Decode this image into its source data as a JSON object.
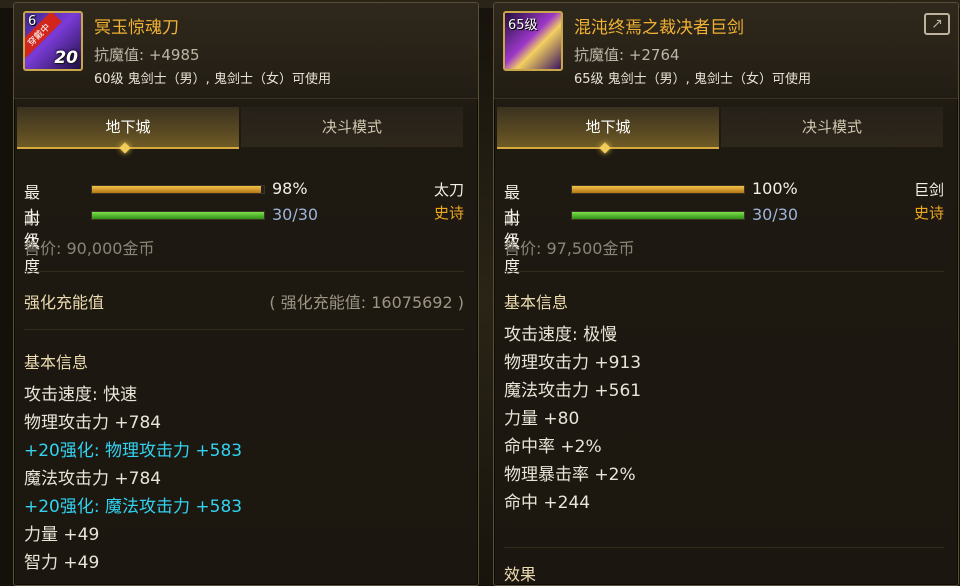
{
  "left": {
    "item": {
      "icon_level": "6",
      "icon_stamp": "穿戴中",
      "icon_plus": "20",
      "name": "冥玉惊魂刀",
      "resist": "抗魔值: +4985",
      "requirement": "60级 鬼剑士（男）, 鬼剑士（女）可使用"
    },
    "tabs": [
      {
        "label": "地下城",
        "active": true
      },
      {
        "label": "决斗模式",
        "active": false
      }
    ],
    "stats": {
      "grade_label": "最上级",
      "grade_value": "98%",
      "grade_fraction": 0.98,
      "durability_label": "耐久度",
      "durability_value": "30/30",
      "durability_fraction": 1.0
    },
    "type": "太刀",
    "rarity": "史诗",
    "price": "售价: 90,000金币",
    "charge": {
      "label": "强化充能值",
      "value": "( 强化充能值: 16075692 )"
    },
    "basic_title": "基本信息",
    "attributes": [
      {
        "text": "攻击速度: 快速",
        "color": "white"
      },
      {
        "text": "物理攻击力 +784",
        "color": "white"
      },
      {
        "text": "+20强化: 物理攻击力 +583",
        "color": "cyan"
      },
      {
        "text": "魔法攻击力 +784",
        "color": "white"
      },
      {
        "text": "+20强化: 魔法攻击力 +583",
        "color": "cyan"
      },
      {
        "text": "力量 +49",
        "color": "white"
      },
      {
        "text": "智力 +49",
        "color": "white"
      }
    ]
  },
  "right": {
    "item": {
      "icon_level": "65级",
      "name": "混沌终焉之裁决者巨剑",
      "resist": "抗魔值: +2764",
      "requirement": "65级 鬼剑士（男）, 鬼剑士（女）可使用"
    },
    "share_icon": "share-icon",
    "tabs": [
      {
        "label": "地下城",
        "active": true
      },
      {
        "label": "决斗模式",
        "active": false
      }
    ],
    "stats": {
      "grade_label": "最上级",
      "grade_value": "100%",
      "grade_fraction": 1.0,
      "durability_label": "耐久度",
      "durability_value": "30/30",
      "durability_fraction": 1.0
    },
    "type": "巨剑",
    "rarity": "史诗",
    "price": "售价: 97,500金币",
    "basic_title": "基本信息",
    "attributes": [
      {
        "text": "攻击速度: 极慢",
        "color": "white"
      },
      {
        "text": "物理攻击力 +913",
        "color": "white"
      },
      {
        "text": "魔法攻击力 +561",
        "color": "white"
      },
      {
        "text": "力量 +80",
        "color": "white"
      },
      {
        "text": "命中率 +2%",
        "color": "white"
      },
      {
        "text": "物理暴击率 +2%",
        "color": "white"
      },
      {
        "text": "命中 +244",
        "color": "white"
      }
    ],
    "effect_title": "效果"
  }
}
